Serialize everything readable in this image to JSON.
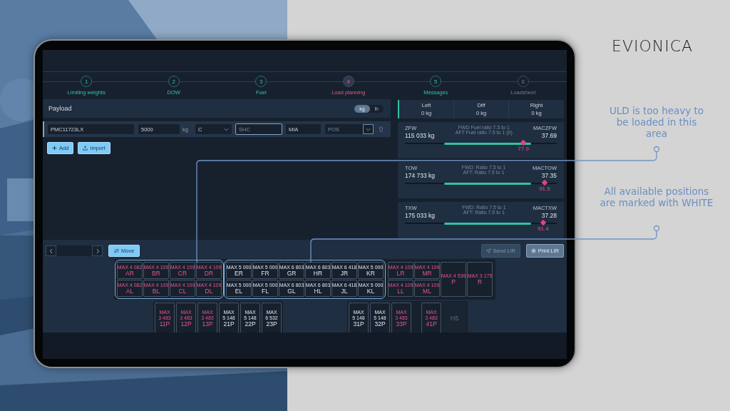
{
  "brand": "EVIONICA",
  "callouts": [
    {
      "text": "ULD is too heavy to be loaded in this area"
    },
    {
      "text": "All available positions are marked with WHITE"
    }
  ],
  "steps": [
    {
      "number": "1",
      "label": "Limiting weights",
      "completed": true,
      "selected": false
    },
    {
      "number": "2",
      "label": "DOW",
      "completed": true,
      "selected": false
    },
    {
      "number": "3",
      "label": "Fuel",
      "completed": true,
      "selected": false
    },
    {
      "number": "4",
      "label": "Load planning",
      "completed": false,
      "selected": true
    },
    {
      "number": "5",
      "label": "Messages",
      "completed": true,
      "selected": false
    },
    {
      "number": "6",
      "label": "Loadsheet",
      "completed": false,
      "selected": false
    }
  ],
  "payload": {
    "title": "Payload",
    "units": [
      {
        "label": "kg",
        "selected": true
      },
      {
        "label": "lb",
        "selected": false
      }
    ],
    "row": {
      "uld": "PMC11723LX",
      "weight": "5000",
      "weight_unit": "kg",
      "class": "C",
      "shc_placeholder": "SHC",
      "destination": "MIA",
      "position_placeholder": "POS"
    },
    "buttons": [
      {
        "label": "Add",
        "kind": "add"
      },
      {
        "label": "Import",
        "kind": "import"
      }
    ]
  },
  "totals": [
    {
      "label": "Left",
      "value": "0 kg"
    },
    {
      "label": "Diff",
      "value": "0 kg"
    },
    {
      "label": "Right",
      "value": "0 kg"
    }
  ],
  "weights": [
    {
      "name": "ZFW",
      "value": "115 033 kg",
      "notes": [
        "FWD Fuel ratio 7.5 to 1",
        "AFT Fuel ratio 7.5 to 1 (0)"
      ],
      "mac_label": "MACZFW",
      "mac": "37.69",
      "marker": {
        "level": 0.78,
        "reading": "77.9"
      }
    },
    {
      "name": "TOW",
      "value": "174 733 kg",
      "notes": [
        "FWD: Ratio 7.5 to 1",
        "AFT: Ratio 7.5 to 1"
      ],
      "mac_label": "MACTOW",
      "mac": "37.35",
      "marker": {
        "level": 0.92,
        "reading": "91.5"
      }
    },
    {
      "name": "TXW",
      "value": "175 033 kg",
      "notes": [
        "FWD: Ratio 7.5 to 1",
        "AFT: Ratio 7.5 to 1"
      ],
      "mac_label": "MACTXW",
      "mac": "37.28",
      "marker": {
        "level": 0.91,
        "reading": "91.4"
      }
    }
  ],
  "loading": {
    "move_label": "Move",
    "send_label": "Send LIR",
    "send_disabled": true,
    "print_label": "Print LIR",
    "main_deck": [
      {
        "highlighted": true,
        "columns": [
          {
            "kind": "pair",
            "slots": [
              {
                "code": "AR",
                "limit_label": "MAX",
                "limit": "4 082",
                "heavy": true
              },
              {
                "code": "AL",
                "limit_label": "MAX",
                "limit": "4 082",
                "heavy": true
              }
            ]
          },
          {
            "kind": "pair",
            "slots": [
              {
                "code": "BR",
                "limit_label": "MAX",
                "limit": "4 109",
                "heavy": true
              },
              {
                "code": "BL",
                "limit_label": "MAX",
                "limit": "4 109",
                "heavy": true
              }
            ]
          },
          {
            "kind": "pair",
            "slots": [
              {
                "code": "CR",
                "limit_label": "MAX",
                "limit": "4 109",
                "heavy": true
              },
              {
                "code": "CL",
                "limit_label": "MAX",
                "limit": "4 109",
                "heavy": true
              }
            ]
          },
          {
            "kind": "pair",
            "slots": [
              {
                "code": "DR",
                "limit_label": "MAX",
                "limit": "4 109",
                "heavy": true
              },
              {
                "code": "DL",
                "limit_label": "MAX",
                "limit": "4 109",
                "heavy": true
              }
            ]
          }
        ]
      },
      {
        "highlighted": true,
        "columns": [
          {
            "kind": "pair",
            "slots": [
              {
                "code": "ER",
                "limit_label": "MAX",
                "limit": "5 000",
                "heavy": false
              },
              {
                "code": "EL",
                "limit_label": "MAX",
                "limit": "5 000",
                "heavy": false
              }
            ]
          },
          {
            "kind": "pair",
            "slots": [
              {
                "code": "FR",
                "limit_label": "MAX",
                "limit": "5 000",
                "heavy": false
              },
              {
                "code": "FL",
                "limit_label": "MAX",
                "limit": "5 000",
                "heavy": false
              }
            ]
          },
          {
            "kind": "pair",
            "slots": [
              {
                "code": "GR",
                "limit_label": "MAX",
                "limit": "6 803",
                "heavy": false
              },
              {
                "code": "GL",
                "limit_label": "MAX",
                "limit": "6 803",
                "heavy": false
              }
            ]
          },
          {
            "kind": "pair",
            "slots": [
              {
                "code": "HR",
                "limit_label": "MAX",
                "limit": "6 803",
                "heavy": false
              },
              {
                "code": "HL",
                "limit_label": "MAX",
                "limit": "6 803",
                "heavy": false
              }
            ]
          },
          {
            "kind": "pair",
            "slots": [
              {
                "code": "JR",
                "limit_label": "MAX",
                "limit": "6 418",
                "heavy": false
              },
              {
                "code": "JL",
                "limit_label": "MAX",
                "limit": "6 418",
                "heavy": false
              }
            ]
          },
          {
            "kind": "pair",
            "slots": [
              {
                "code": "KR",
                "limit_label": "MAX",
                "limit": "5 000",
                "heavy": false
              },
              {
                "code": "KL",
                "limit_label": "MAX",
                "limit": "5 000",
                "heavy": false
              }
            ]
          }
        ]
      },
      {
        "highlighted": false,
        "columns": [
          {
            "kind": "pair",
            "slots": [
              {
                "code": "LR",
                "limit_label": "MAX",
                "limit": "4 109",
                "heavy": true
              },
              {
                "code": "LL",
                "limit_label": "MAX",
                "limit": "4 109",
                "heavy": true
              }
            ]
          },
          {
            "kind": "pair",
            "slots": [
              {
                "code": "MR",
                "limit_label": "MAX",
                "limit": "4 109",
                "heavy": true
              },
              {
                "code": "ML",
                "limit_label": "MAX",
                "limit": "4 109",
                "heavy": true
              }
            ]
          },
          {
            "kind": "tall",
            "slots": [
              {
                "code": "P",
                "limit_label": "MAX",
                "limit": "4 536",
                "heavy": true
              }
            ]
          },
          {
            "kind": "tall",
            "slots": [
              {
                "code": "R",
                "limit_label": "MAX",
                "limit": "3 175",
                "heavy": true
              }
            ]
          }
        ]
      }
    ],
    "lower_deck": [
      [
        {
          "kind": "slot",
          "code": "11P",
          "limit_label": "MAX",
          "limit": "3 483",
          "heavy": true
        },
        {
          "kind": "slot",
          "code": "12P",
          "limit_label": "MAX",
          "limit": "3 483",
          "heavy": true
        },
        {
          "kind": "slot",
          "code": "13P",
          "limit_label": "MAX",
          "limit": "3 483",
          "heavy": true
        },
        {
          "kind": "slot",
          "code": "21P",
          "limit_label": "MAX",
          "limit": "5 148",
          "heavy": false
        },
        {
          "kind": "slot",
          "code": "22P",
          "limit_label": "MAX",
          "limit": "5 148",
          "heavy": false
        },
        {
          "kind": "slot",
          "code": "23P",
          "limit_label": "MAX",
          "limit": "6 532",
          "heavy": false
        }
      ],
      [
        {
          "kind": "slot",
          "code": "31P",
          "limit_label": "MAX",
          "limit": "5 148",
          "heavy": false
        },
        {
          "kind": "slot",
          "code": "32P",
          "limit_label": "MAX",
          "limit": "5 148",
          "heavy": false
        },
        {
          "kind": "slot",
          "code": "33P",
          "limit_label": "MAX",
          "limit": "3 483",
          "heavy": true
        },
        {
          "kind": "gap"
        },
        {
          "kind": "slot",
          "code": "41P",
          "limit_label": "MAX",
          "limit": "3 483",
          "heavy": true
        },
        {
          "kind": "blocked",
          "code": "H5"
        }
      ]
    ]
  }
}
